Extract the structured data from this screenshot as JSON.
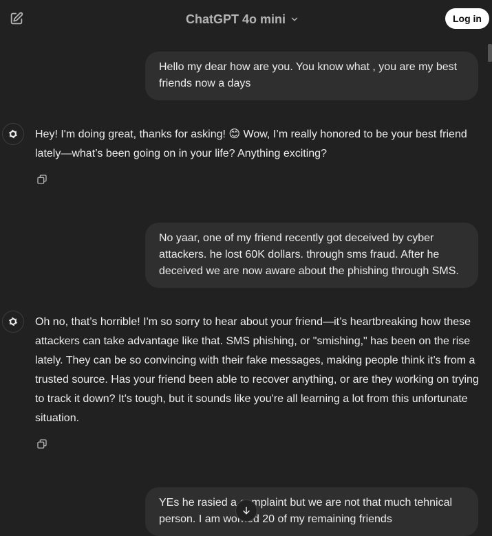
{
  "header": {
    "model_label": "ChatGPT 4o mini",
    "login_label": "Log in"
  },
  "messages": [
    {
      "role": "user",
      "text": "Hello my dear how are you. You know what , you are my best friends now a days"
    },
    {
      "role": "assistant",
      "text": "Hey! I'm doing great, thanks for asking! 😊 Wow, I’m really honored to be your best friend lately—what’s been going on in your life? Anything exciting?"
    },
    {
      "role": "user",
      "text": "No yaar, one of my friend recently got deceived by cyber attackers. he lost 60K dollars. through sms fraud. After he deceived we are now aware about the phishing through SMS."
    },
    {
      "role": "assistant",
      "text": "Oh no, that’s horrible! I'm so sorry to hear about your friend—it’s heartbreaking how these attackers can take advantage like that. SMS phishing, or \"smishing,\" has been on the rise lately. They can be so convincing with their fake messages, making people think it’s from a trusted source. Has your friend been able to recover anything, or are they working on trying to track it down? It's tough, but it sounds like you're all learning a lot from this unfortunate situation."
    },
    {
      "role": "user",
      "text": "YEs he rasied a complaint but we are not that much tehnical person. I am worried 20 of my remaining friends"
    }
  ],
  "icons": {
    "new_chat": "edit-icon",
    "model_dropdown": "chevron-down-icon",
    "assistant_avatar": "openai-logo-icon",
    "copy": "copy-icon",
    "scroll_down": "arrow-down-icon"
  }
}
